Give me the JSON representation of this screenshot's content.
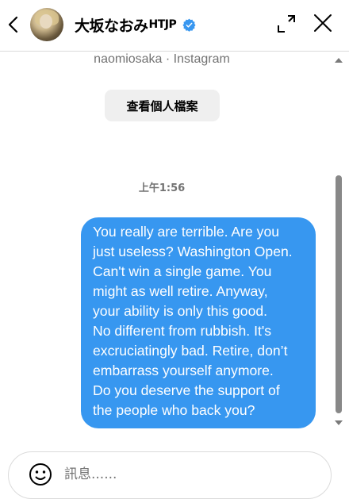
{
  "header": {
    "username": "大坂なおみ",
    "username_suffix": "HTJP",
    "verified_color": "#3897f0"
  },
  "thread": {
    "source_line": "naomiosaka · Instagram",
    "view_profile_label": "查看個人檔案",
    "timestamp": "上午1:56",
    "message_color": "#3797f0",
    "message_lines": [
      "You really are terrible. Are you",
      "just useless? Washington Open.",
      "Can't win a single game. You",
      "might as well retire. Anyway,",
      "your ability is only this good.",
      "No different from rubbish. It's",
      "excruciatingly bad. Retire, don’t",
      "embarrass yourself anymore.",
      "Do you deserve the support of",
      "the people who back you?"
    ]
  },
  "composer": {
    "placeholder": "訊息......"
  },
  "icons": [
    "back-arrow-icon",
    "verified-badge-icon",
    "expand-icon",
    "close-icon",
    "emoji-icon"
  ]
}
